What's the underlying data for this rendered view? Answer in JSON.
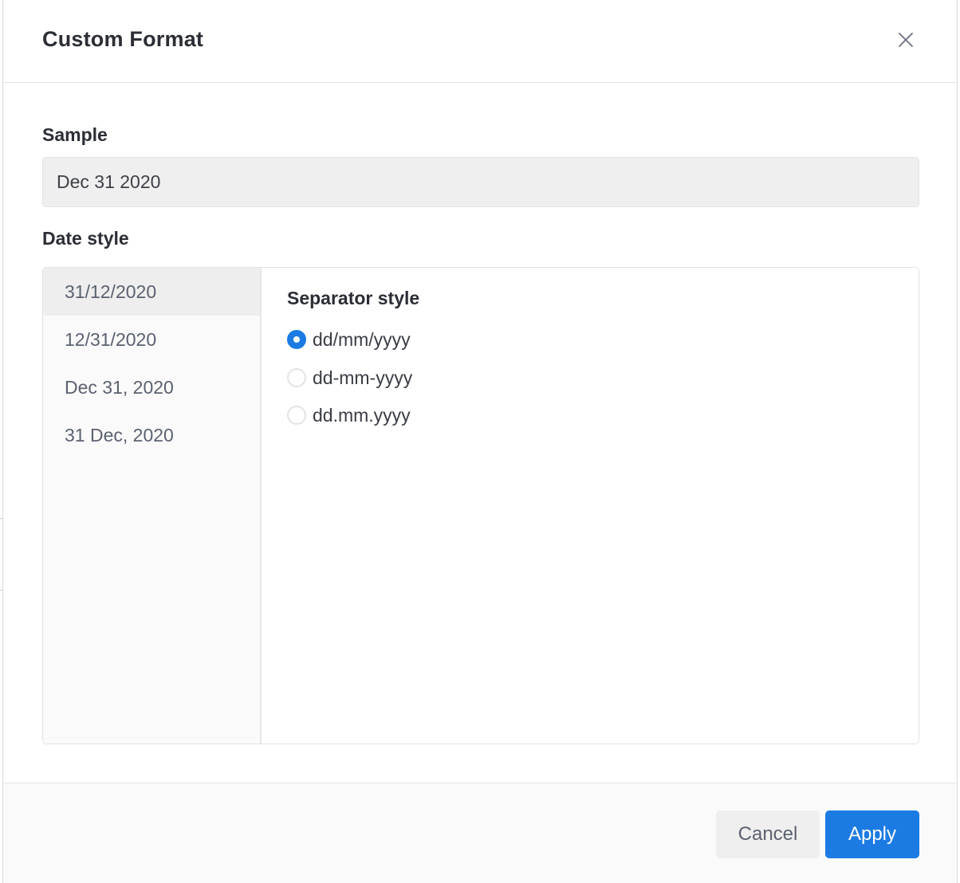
{
  "dialog": {
    "title": "Custom Format",
    "close_icon": "close-icon"
  },
  "sample": {
    "label": "Sample",
    "value": "Dec 31 2020"
  },
  "date_style": {
    "label": "Date style",
    "items": [
      {
        "label": "31/12/2020",
        "selected": true
      },
      {
        "label": "12/31/2020",
        "selected": false
      },
      {
        "label": "Dec 31, 2020",
        "selected": false
      },
      {
        "label": "31 Dec, 2020",
        "selected": false
      }
    ]
  },
  "separator": {
    "title": "Separator style",
    "options": [
      {
        "label": "dd/mm/yyyy",
        "checked": true
      },
      {
        "label": "dd-mm-yyyy",
        "checked": false
      },
      {
        "label": "dd.mm.yyyy",
        "checked": false
      }
    ]
  },
  "footer": {
    "cancel_label": "Cancel",
    "apply_label": "Apply"
  },
  "colors": {
    "accent": "#1b7be3",
    "selected_item_bg": "#eeeeee",
    "sample_bg": "#efefef"
  }
}
